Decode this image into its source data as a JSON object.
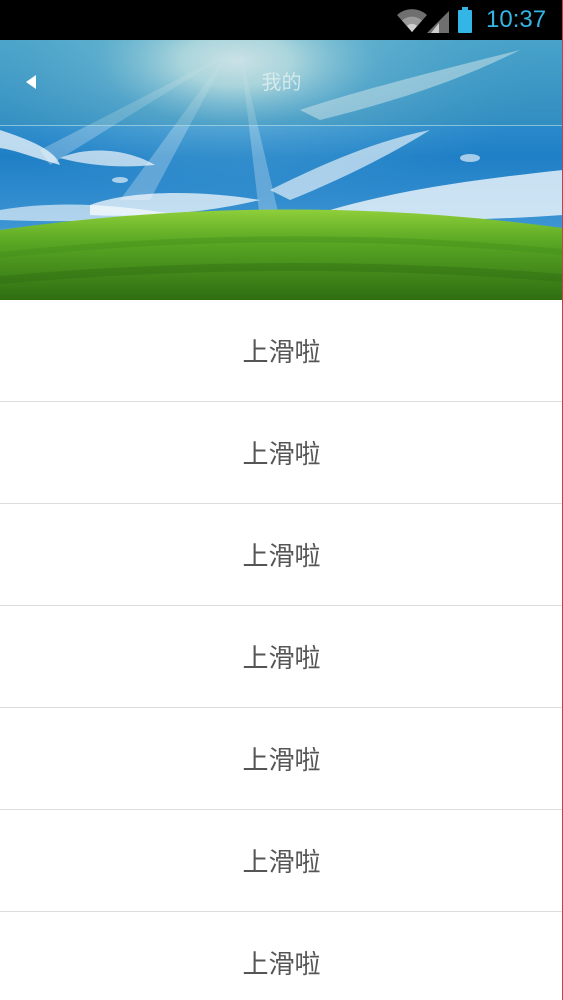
{
  "status_bar": {
    "time": "10:37",
    "icons": [
      "wifi-icon",
      "signal-icon",
      "battery-icon"
    ],
    "clock_color": "#33b5e5"
  },
  "header": {
    "title": "我的",
    "back_icon": "back-arrow-icon",
    "background": "sky-and-grass-photo"
  },
  "list": {
    "items": [
      {
        "label": "上滑啦"
      },
      {
        "label": "上滑啦"
      },
      {
        "label": "上滑啦"
      },
      {
        "label": "上滑啦"
      },
      {
        "label": "上滑啦"
      },
      {
        "label": "上滑啦"
      },
      {
        "label": "上滑啦"
      }
    ]
  }
}
